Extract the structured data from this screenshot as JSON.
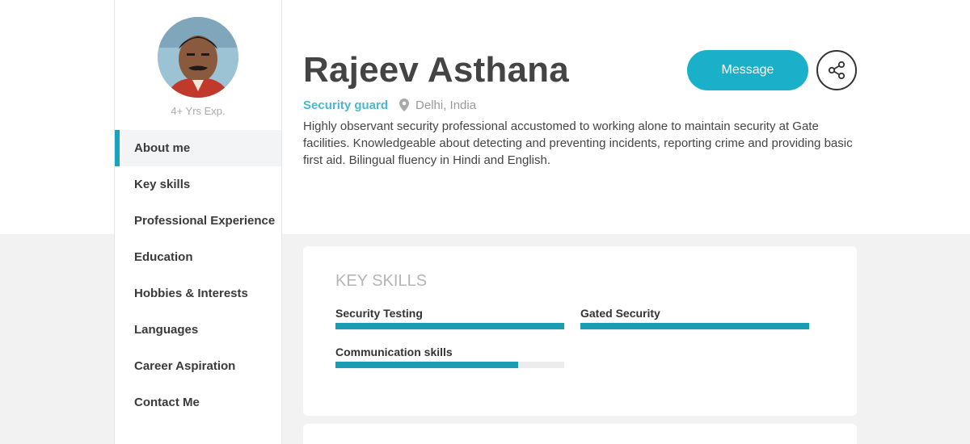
{
  "profile": {
    "name": "Rajeev Asthana",
    "experience": "4+ Yrs Exp.",
    "job_title": "Security guard",
    "location": "Delhi, India",
    "bio": "Highly observant security professional accustomed to working alone to maintain security at Gate facilities. Knowledgeable about detecting and preventing incidents, reporting crime and providing basic first aid. Bilingual fluency in Hindi and English."
  },
  "actions": {
    "message_label": "Message",
    "share_icon": "share-icon"
  },
  "sidebar": {
    "items": [
      {
        "label": "About me",
        "active": true
      },
      {
        "label": "Key skills"
      },
      {
        "label": "Professional Experience"
      },
      {
        "label": "Education"
      },
      {
        "label": "Hobbies & Interests"
      },
      {
        "label": "Languages"
      },
      {
        "label": "Career Aspiration"
      },
      {
        "label": "Contact Me"
      }
    ]
  },
  "key_skills": {
    "title": "KEY SKILLS",
    "skills": [
      {
        "name": "Security Testing",
        "level": 1.0
      },
      {
        "name": "Gated Security",
        "level": 1.0
      },
      {
        "name": "Communication skills",
        "level": 0.8
      }
    ]
  },
  "colors": {
    "accent": "#1ab0c9",
    "skill_bar": "#1a9db3",
    "job_title": "#4bb8cc"
  }
}
